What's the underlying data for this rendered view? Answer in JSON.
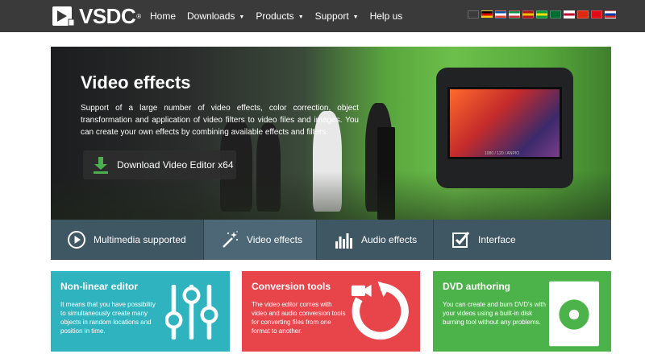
{
  "header": {
    "logo_text": "VSDC",
    "logo_reg": "®",
    "nav": [
      {
        "label": "Home",
        "dropdown": false
      },
      {
        "label": "Downloads",
        "dropdown": true
      },
      {
        "label": "Products",
        "dropdown": true
      },
      {
        "label": "Support",
        "dropdown": true
      },
      {
        "label": "Help us",
        "dropdown": false
      }
    ],
    "chevron": "⌄",
    "flags": [
      {
        "lang": "en",
        "colors": [
          "#012169",
          "#c8102e"
        ]
      },
      {
        "lang": "de",
        "colors": [
          "#000000",
          "#dd0000",
          "#ffce00"
        ]
      },
      {
        "lang": "fr",
        "colors": [
          "#0055a4",
          "#ffffff",
          "#ef4135"
        ]
      },
      {
        "lang": "it",
        "colors": [
          "#009246",
          "#ffffff",
          "#ce2b37"
        ]
      },
      {
        "lang": "es",
        "colors": [
          "#aa151b",
          "#f1bf00",
          "#aa151b"
        ]
      },
      {
        "lang": "br",
        "colors": [
          "#009c3b",
          "#ffdf00",
          "#009c3b"
        ]
      },
      {
        "lang": "ar",
        "colors": [
          "#006c35",
          "#006c35",
          "#006c35"
        ]
      },
      {
        "lang": "jp",
        "colors": [
          "#ffffff",
          "#bc002d",
          "#ffffff"
        ]
      },
      {
        "lang": "cn",
        "colors": [
          "#de2910",
          "#de2910",
          "#de2910"
        ]
      },
      {
        "lang": "tr",
        "colors": [
          "#e30a17",
          "#e30a17",
          "#e30a17"
        ]
      },
      {
        "lang": "ru",
        "colors": [
          "#ffffff",
          "#0039a6",
          "#d52b1e"
        ]
      }
    ]
  },
  "hero": {
    "title": "Video effects",
    "description": "Support of a large number of video effects, color correction, object transformation and application of video filters to video files and images. You can create your own effects by combining available effects and filters.",
    "camera_readout": "1080 / 120 / ANPIO",
    "download_button": "Download Video Editor x64"
  },
  "tabs": [
    {
      "label": "Multimedia supported",
      "icon": "play-circle-icon",
      "active": false
    },
    {
      "label": "Video effects",
      "icon": "magic-wand-icon",
      "active": true
    },
    {
      "label": "Audio effects",
      "icon": "equalizer-icon",
      "active": false
    },
    {
      "label": "Interface",
      "icon": "checkbox-edit-icon",
      "active": false
    }
  ],
  "cards": [
    {
      "title": "Non-linear editor",
      "text": "It means that you have possibility to simultaneously create many objects in random locations and position in time.",
      "color": "#2fb3bf",
      "icon": "sliders-icon"
    },
    {
      "title": "Conversion tools",
      "text": "The video editor comes with video and audio conversion tools for converting files from one format to another.",
      "color": "#e8454b",
      "icon": "convert-icon"
    },
    {
      "title": "DVD authoring",
      "text": "You can create and burn DVD's with your videos using a built-in disk burning tool without any problems.",
      "color": "#4bb34a",
      "icon": "dvd-icon"
    }
  ],
  "colors": {
    "header_bg": "#3a3a3a",
    "tabs_bg": "#3f5663",
    "tab_active_bg": "#4d6776",
    "download_icon": "#4caf50"
  }
}
